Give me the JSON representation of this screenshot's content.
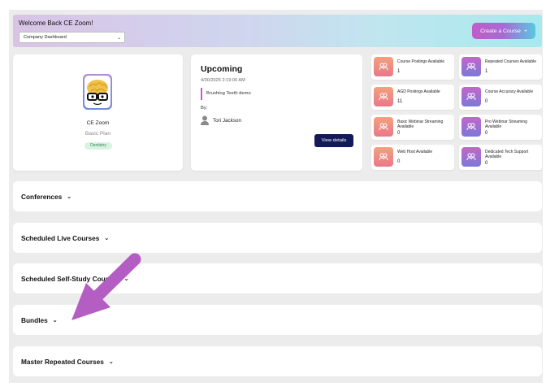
{
  "header": {
    "welcome": "Welcome Back CE Zoom!",
    "dashboard_select": "Company Dashboard",
    "create_course_label": "Create a Course",
    "create_course_icon": "plus-icon"
  },
  "profile": {
    "name": "CE Zoom",
    "plan": "Basic Plan",
    "tag": "Dentistry"
  },
  "upcoming": {
    "title": "Upcoming",
    "datetime": "4/30/2025 2:19:00 AM",
    "event": "Brushing Teeth demo",
    "by_label": "By:",
    "host": "Tori Jackson",
    "view_details": "View details"
  },
  "stats": [
    {
      "label": "Course Postings Available",
      "value": "1"
    },
    {
      "label": "Repeated Courses Available",
      "value": "1"
    },
    {
      "label": "AGD Postings Available",
      "value": "11"
    },
    {
      "label": "Course Accuracy Available",
      "value": "0"
    },
    {
      "label": "Basic Webinar Streaming Available",
      "value": "0"
    },
    {
      "label": "Pro Webinar Streaming Available",
      "value": "0"
    },
    {
      "label": "Web Host Available",
      "value": "0"
    },
    {
      "label": "Dedicated Tech Support Available",
      "value": "0"
    }
  ],
  "sections": [
    {
      "label": "Conferences"
    },
    {
      "label": "Scheduled Live Courses"
    },
    {
      "label": "Scheduled Self-Study Courses"
    },
    {
      "label": "Bundles"
    },
    {
      "label": "Master Repeated Courses"
    }
  ],
  "colors": {
    "accent_purple": "#c25bc9",
    "accent_cyan": "#59c8e0",
    "navy_button": "#141a57",
    "annotation_arrow": "#b45ec4"
  }
}
